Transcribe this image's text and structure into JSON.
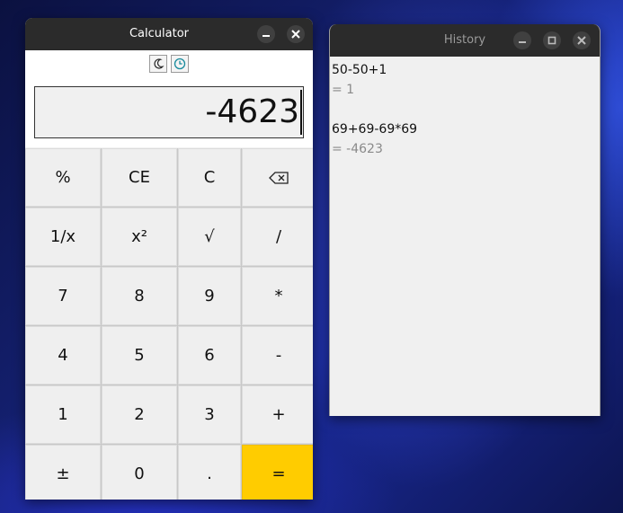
{
  "calculator": {
    "title": "Calculator",
    "toolbar": {
      "theme_icon": "moon-icon",
      "history_icon": "clock-icon"
    },
    "display": "-4623",
    "keys": [
      "%",
      "CE",
      "C",
      "⌫",
      "1/x",
      "x²",
      "√",
      "/",
      "7",
      "8",
      "9",
      "*",
      "4",
      "5",
      "6",
      "-",
      "1",
      "2",
      "3",
      "+",
      "±",
      "0",
      ".",
      "="
    ],
    "accent": "#ffcc00"
  },
  "history": {
    "title": "History",
    "entries": [
      {
        "expression": "50-50+1",
        "result": "= 1"
      },
      {
        "expression": "69+69-69*69",
        "result": "= -4623"
      }
    ]
  }
}
